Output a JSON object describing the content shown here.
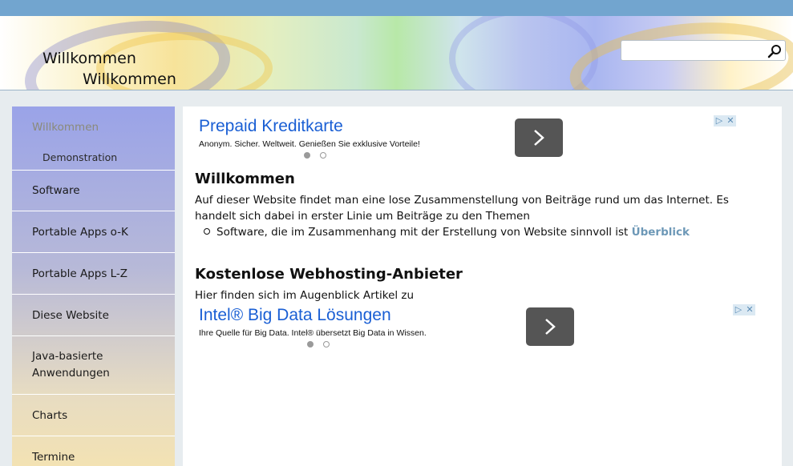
{
  "header": {
    "logo_line1": "Willkommen",
    "logo_line2": "Willkommen",
    "search_placeholder": "",
    "search_value": ""
  },
  "sidebar": {
    "items": [
      {
        "label": "Willkommen",
        "active": true
      },
      {
        "label": "Software"
      },
      {
        "label": "Portable Apps o-K"
      },
      {
        "label": "Portable Apps L-Z"
      },
      {
        "label": "Diese Website"
      },
      {
        "label": "Java-basierte Anwendungen"
      },
      {
        "label": "Charts"
      },
      {
        "label": "Termine"
      }
    ],
    "sub_item": "Demonstration"
  },
  "ads": [
    {
      "title": "Prepaid Kreditkarte",
      "text": "Anonym. Sicher. Weltweit. Genießen Sie exklusive Vorteile!"
    },
    {
      "title": "Intel® Big Data Lösungen",
      "text": "Ihre Quelle für Big Data. Intel® übersetzt Big Data in Wissen."
    }
  ],
  "main": {
    "heading1": "Willkommen",
    "para1": "Auf dieser Website findet man eine lose Zusammenstellung von Beiträge rund um das Internet. Es handelt sich dabei in erster Linie um Beiträge zu den Themen",
    "list_item_text": "Software, die im Zusammenhang mit der Erstellung von Website sinnvoll ist",
    "list_item_link": "Überblick",
    "heading2": "Kostenlose Webhosting-Anbieter",
    "para2": "Hier finden sich im Augenblick Artikel zu"
  },
  "colors": {
    "topbar": "#72a5cf",
    "ad_title": "#1a5fd4",
    "link": "#6d98b7"
  }
}
